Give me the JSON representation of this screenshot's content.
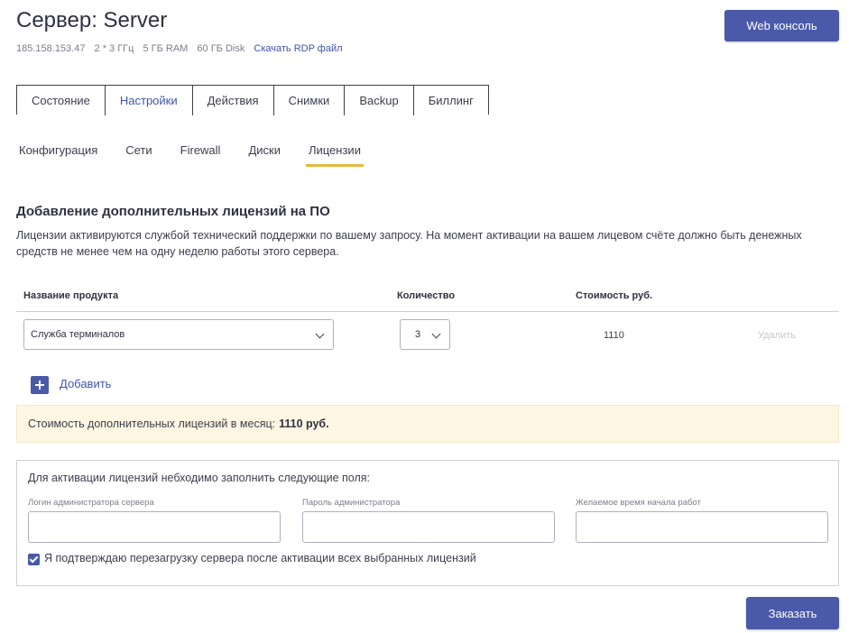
{
  "header": {
    "title": "Сервер: Server",
    "specs": [
      "185.158.153.47",
      "2 * 3 ГГц",
      "5 ГБ RAM",
      "60 ГБ Disk"
    ],
    "rdp_link": "Скачать RDP файл",
    "web_console_label": "Web консоль"
  },
  "tabs": [
    {
      "label": "Состояние"
    },
    {
      "label": "Настройки",
      "active": true
    },
    {
      "label": "Действия"
    },
    {
      "label": "Снимки"
    },
    {
      "label": "Backup"
    },
    {
      "label": "Биллинг"
    }
  ],
  "subtabs": [
    {
      "label": "Конфигурация"
    },
    {
      "label": "Сети"
    },
    {
      "label": "Firewall"
    },
    {
      "label": "Диски"
    },
    {
      "label": "Лицензии",
      "active": true
    }
  ],
  "licenses": {
    "title": "Добавление дополнительных лицензий на ПО",
    "info": "Лицензии активируются службой технический поддержки по вашему запросу. На момент активации на вашем лицевом счёте должно быть денежных средств не менее чем на одну неделю работы этого сервера.",
    "columns": {
      "product": "Название продукта",
      "quantity": "Количество",
      "cost": "Стоимость руб."
    },
    "rows": [
      {
        "product": "Служба терминалов",
        "quantity": "3",
        "cost": "1110",
        "delete_label": "Удалить"
      }
    ],
    "add_label": "Добавить",
    "summary_label": "Стоимость дополнительных лицензий в месяц:",
    "summary_value": "1110 руб."
  },
  "activation": {
    "title": "Для активации лицензий небходимо заполнить следующие поля:",
    "fields": [
      {
        "label": "Логин администратора сервера",
        "value": ""
      },
      {
        "label": "Пароль администратора",
        "value": ""
      },
      {
        "label": "Желаемое время начала работ",
        "value": ""
      }
    ],
    "confirm_label": "Я подтверждаю перезагрузку сервера после активации всех выбранных лицензий",
    "confirm_checked": true
  },
  "order_label": "Заказать",
  "colors": {
    "accent": "#4a5aa8",
    "link": "#3f55a8",
    "tab_underline": "#e8b93f",
    "summary_bg": "#fdf6e2"
  }
}
